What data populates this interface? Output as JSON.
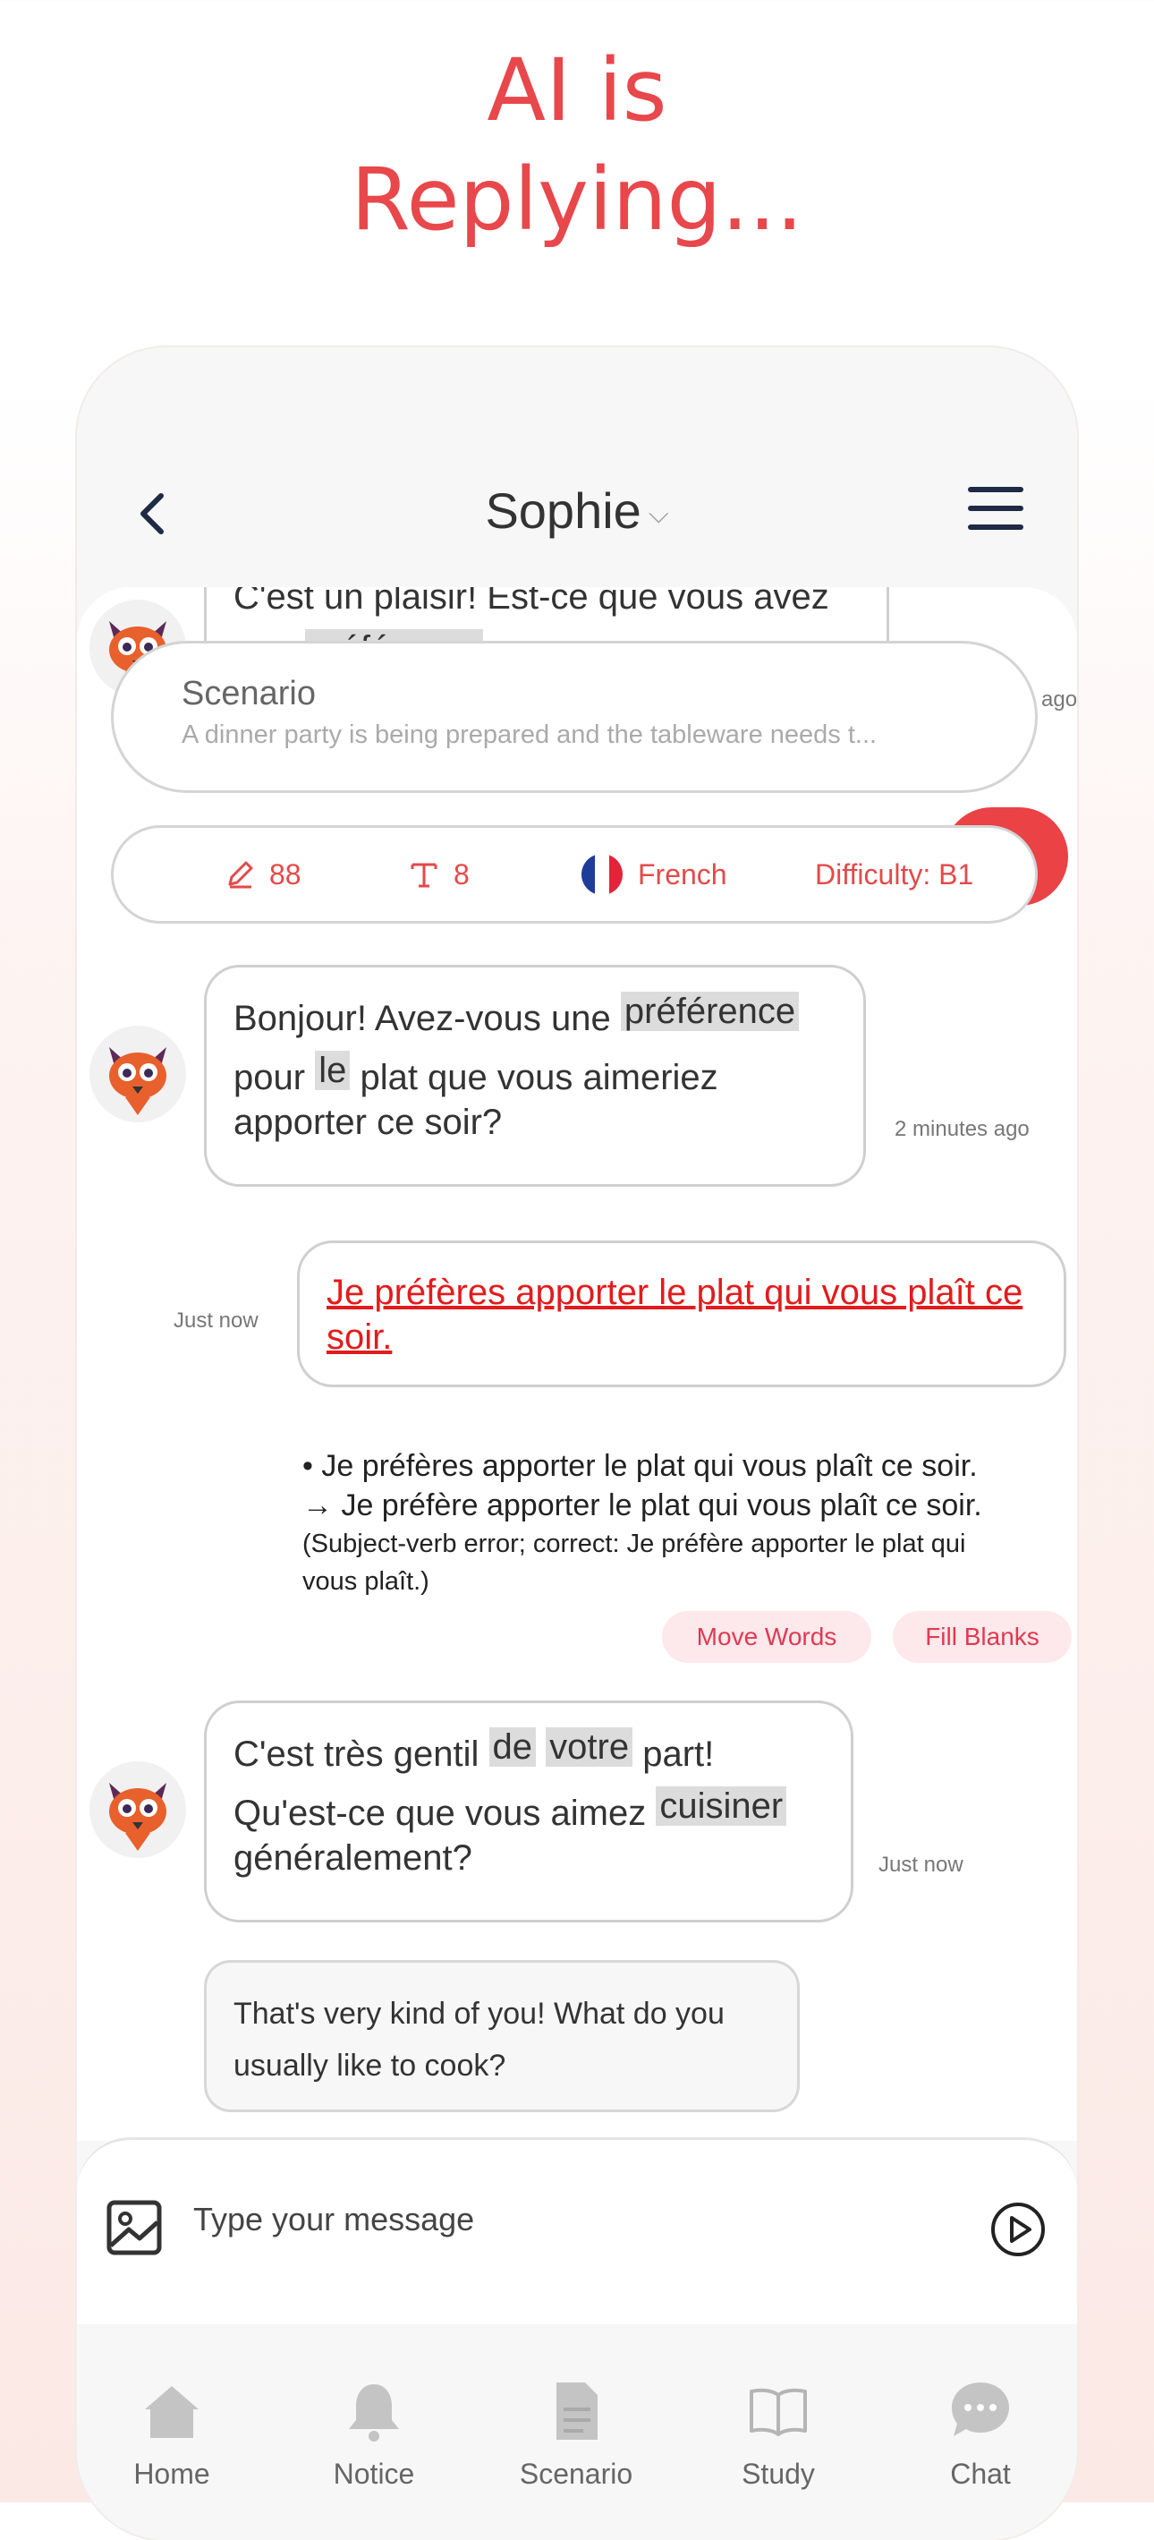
{
  "promo": {
    "line1": "AI is",
    "line2": "Replying..."
  },
  "header": {
    "name": "Sophie"
  },
  "scenario": {
    "title": "Scenario",
    "description": "A dinner party is being prepared and the tableware needs t..."
  },
  "stats": {
    "edits": "88",
    "text": "8",
    "language": "French",
    "difficulty": "Difficulty: B1"
  },
  "messages": {
    "top_partial": {
      "text": "C'est un plaisir! Est-ce que vous avez",
      "hl": "préférence",
      "ts": "ago"
    },
    "m1": {
      "p1": "Bonjour! Avez-vous une",
      "hl1": "préférence",
      "p2": "pour",
      "hl2": "le",
      "p3": "plat que vous aimeriez",
      "p4": "apporter ce soir?",
      "ts": "2 minutes ago"
    },
    "user": {
      "text": "Je préfères apporter le plat qui vous plaît ce soir.",
      "ts": "Just now"
    },
    "correction": {
      "l1": "• Je préfères apporter le plat qui vous plaît ce soir.",
      "l2": "→ Je préfère apporter le plat qui vous plaît ce soir.",
      "l3": "(Subject-verb error; correct: Je préfère apporter le plat qui",
      "l4": "vous plaît.)"
    },
    "chips": {
      "move": "Move Words",
      "fill": "Fill Blanks"
    },
    "m2": {
      "p1": "C'est très gentil",
      "hl1": "de",
      "hl2": "votre",
      "p2": "part!",
      "p3": "Qu'est-ce que vous aimez",
      "hl3": "cuisiner",
      "p4": "généralement?",
      "ts": "Just now"
    },
    "translation": {
      "l1": "That's very kind of you! What do you",
      "l2": "usually like to cook?"
    }
  },
  "composer": {
    "placeholder": "Type your message"
  },
  "tabs": [
    {
      "label": "Home",
      "icon": "home-icon"
    },
    {
      "label": "Notice",
      "icon": "bell-icon"
    },
    {
      "label": "Scenario",
      "icon": "document-icon"
    },
    {
      "label": "Study",
      "icon": "book-icon"
    },
    {
      "label": "Chat",
      "icon": "chat-icon"
    }
  ],
  "colors": {
    "accent": "#e8474b",
    "user_text": "#e21c1c",
    "chip_bg": "#fde8eb"
  }
}
